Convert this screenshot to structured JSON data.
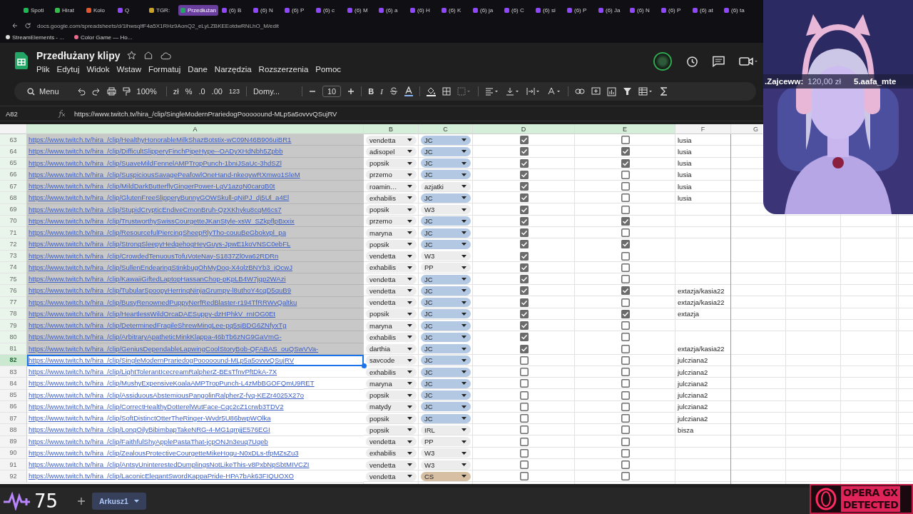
{
  "browser": {
    "tabs": [
      {
        "label": "Spoti",
        "color": "#1db954",
        "selected": false
      },
      {
        "label": "Hirat",
        "color": "#2fbf4a",
        "selected": false
      },
      {
        "label": "Kolo",
        "color": "#e4572e",
        "selected": false
      },
      {
        "label": "Q",
        "color": "#9146ff",
        "selected": false
      },
      {
        "label": "TGR:",
        "color": "#c9a227",
        "selected": false
      },
      {
        "label": "Przedłużan",
        "color": "#23a566",
        "selected": true
      },
      {
        "label": "(6) B",
        "color": "#9146ff",
        "selected": false
      },
      {
        "label": "(6) N",
        "color": "#9146ff",
        "selected": false
      },
      {
        "label": "(6) P",
        "color": "#9146ff",
        "selected": false
      },
      {
        "label": "(6) c",
        "color": "#9146ff",
        "selected": false
      },
      {
        "label": "(6) M",
        "color": "#9146ff",
        "selected": false
      },
      {
        "label": "(6) a",
        "color": "#9146ff",
        "selected": false
      },
      {
        "label": "(6) H",
        "color": "#9146ff",
        "selected": false
      },
      {
        "label": "(6) K",
        "color": "#9146ff",
        "selected": false
      },
      {
        "label": "(6) ja",
        "color": "#9146ff",
        "selected": false
      },
      {
        "label": "(6) C",
        "color": "#9146ff",
        "selected": false
      },
      {
        "label": "(6) si",
        "color": "#9146ff",
        "selected": false
      },
      {
        "label": "(6) P",
        "color": "#9146ff",
        "selected": false
      },
      {
        "label": "(6) Ja",
        "color": "#9146ff",
        "selected": false
      },
      {
        "label": "(6) N",
        "color": "#9146ff",
        "selected": false
      },
      {
        "label": "(6) P",
        "color": "#9146ff",
        "selected": false
      },
      {
        "label": "(6) at",
        "color": "#9146ff",
        "selected": false
      },
      {
        "label": "(6) ta",
        "color": "#9146ff",
        "selected": false
      }
    ],
    "url": "docs.google.com/spreadsheets/d/1lhwsqlfF4a5X1RHz9AonQ2_eLyLZBKEEotdwRNLhO_M/edit",
    "bookmarks": [
      "StreamElements - ...",
      "Color Game — Ho..."
    ]
  },
  "sheets": {
    "title": "Przedłużany klipy",
    "menu": [
      "Plik",
      "Edytuj",
      "Widok",
      "Wstaw",
      "Formatuj",
      "Dane",
      "Narzędzia",
      "Rozszerzenia",
      "Pomoc"
    ],
    "toolbar": {
      "search": "Menu",
      "zoom": "100%",
      "currency": "zł",
      "percent": "%",
      "dec_less": ".0",
      "dec_more": ".00",
      "number_format": "123",
      "font": "Domy...",
      "font_size": "10",
      "bold": "B",
      "italic": "I"
    },
    "name_box": "A82",
    "formula": "https://www.twitch.tv/hira_/clip/SingleModernPrariedogPooooound-MLp5a5ovvvQSujRV",
    "columns": [
      {
        "label": "A",
        "selected": true
      },
      {
        "label": "B",
        "selected": true
      },
      {
        "label": "C",
        "selected": true
      },
      {
        "label": "D",
        "selected": true
      },
      {
        "label": "E",
        "selected": true
      },
      {
        "label": "F",
        "selected": false
      },
      {
        "label": "G",
        "selected": false
      }
    ],
    "rows": [
      {
        "num": "63",
        "a": "https://www.twitch.tv/hira_/clip/HealthyHonorableMilkShazBotstix-wC09N46B906uiBR1",
        "b": "vendetta",
        "c": {
          "value": "JC",
          "color": "#b3c8e2"
        },
        "d_checked": true,
        "e_checked": false,
        "f": "lusia",
        "shaded": true,
        "selected": false
      },
      {
        "num": "64",
        "a": "https://www.twitch.tv/hira_/clip/DifficultSlipperyFinchPipeHype--OADyXHdNbh5Zpbb",
        "b": "adisopel",
        "c": {
          "value": "JC",
          "color": "#b3c8e2"
        },
        "d_checked": true,
        "e_checked": true,
        "f": "lusia",
        "shaded": true,
        "selected": false
      },
      {
        "num": "65",
        "a": "https://www.twitch.tv/hira_/clip/SuaveMildFennelAMPTropPunch-1bniJSaUc-3hdSZl",
        "b": "popsik",
        "c": {
          "value": "JC",
          "color": "#b3c8e2"
        },
        "d_checked": true,
        "e_checked": true,
        "f": "lusia",
        "shaded": true,
        "selected": false
      },
      {
        "num": "66",
        "a": "https://www.twitch.tv/hira_/clip/SuspiciousSavagePeafowlOneHand-nkeoywRXmwo1SleM",
        "b": "przemo",
        "c": {
          "value": "JC",
          "color": "#b3c8e2"
        },
        "d_checked": true,
        "e_checked": false,
        "f": "lusia",
        "shaded": true,
        "selected": false
      },
      {
        "num": "67",
        "a": "https://www.twitch.tv/hira_/clip/MildDarkButterflyGingerPower-LqV1azqN0carqB0t",
        "b": "roamin…",
        "c": {
          "value": "azjatki",
          "color": "#ececec"
        },
        "d_checked": true,
        "e_checked": false,
        "f": "lusia",
        "shaded": true,
        "selected": false
      },
      {
        "num": "68",
        "a": "https://www.twitch.tv/hira_/clip/GlutenFreeSlipperyBunnyGOWSkull-qNiPJ_dj5Ul_a4El",
        "b": "exhabilis",
        "c": {
          "value": "JC",
          "color": "#b3c8e2"
        },
        "d_checked": true,
        "e_checked": false,
        "f": "lusia",
        "shaded": true,
        "selected": false
      },
      {
        "num": "69",
        "a": "https://www.twitch.tv/hira_/clip/StupidCrypticEndiveCmonBruh-QzXKhyku8cqM6cs7",
        "b": "popsik",
        "c": {
          "value": "W3",
          "color": "#ececec"
        },
        "d_checked": true,
        "e_checked": false,
        "shaded": true,
        "selected": false
      },
      {
        "num": "70",
        "a": "https://www.twitch.tv/hira_/clip/TrustworthySwissCourgetteJKanStyle-xsW_SZkpflpBxxix",
        "b": "przemo",
        "c": {
          "value": "JC",
          "color": "#b3c8e2"
        },
        "d_checked": true,
        "e_checked": true,
        "shaded": true,
        "selected": false
      },
      {
        "num": "71",
        "a": "https://www.twitch.tv/hira_/clip/ResourcefulPiercingSheepRlyTho-couuBeGbokvpl_pa",
        "b": "maryna",
        "c": {
          "value": "JC",
          "color": "#b3c8e2"
        },
        "d_checked": true,
        "e_checked": false,
        "shaded": true,
        "selected": false
      },
      {
        "num": "72",
        "a": "https://www.twitch.tv/hira_/clip/StrongSleepyHedgehogHeyGuys-JpwE1koVNSC0ebFL",
        "b": "popsik",
        "c": {
          "value": "JC",
          "color": "#b3c8e2"
        },
        "d_checked": true,
        "e_checked": true,
        "shaded": true,
        "selected": false
      },
      {
        "num": "73",
        "a": "https://www.twitch.tv/hira_/clip/CrowdedTenuousTofuVoteNay-S1837Zl0va62RDRn",
        "b": "vendetta",
        "c": {
          "value": "W3",
          "color": "#ececec"
        },
        "d_checked": true,
        "e_checked": false,
        "shaded": true,
        "selected": false
      },
      {
        "num": "74",
        "a": "https://www.twitch.tv/hira_/clip/SullenEndearingStinkbugOhMyDog-X4olzBNYb3_jOcwJ",
        "b": "exhabilis",
        "c": {
          "value": "PP",
          "color": "#ececec"
        },
        "d_checked": true,
        "e_checked": false,
        "shaded": true,
        "selected": false
      },
      {
        "num": "75",
        "a": "https://www.twitch.tv/hira_/clip/KawaiiGiftedLaptopHassanChop-pKpLB4W7jqp2WAzi",
        "b": "vendetta",
        "c": {
          "value": "JC",
          "color": "#b3c8e2"
        },
        "d_checked": true,
        "e_checked": false,
        "shaded": true,
        "selected": false
      },
      {
        "num": "76",
        "a": "https://www.twitch.tv/hira_/clip/TubularSpoopyHerringNinjaGrumpy-l8uthoY4cqD5quB9",
        "b": "vendetta",
        "c": {
          "value": "JC",
          "color": "#b3c8e2"
        },
        "d_checked": true,
        "e_checked": true,
        "f": "extazja/kasia22",
        "shaded": true,
        "selected": false
      },
      {
        "num": "77",
        "a": "https://www.twitch.tv/hira_/clip/BusyRenownedPuppyNerfRedBlaster-r194TfRRWvQaltku",
        "b": "vendetta",
        "c": {
          "value": "JC",
          "color": "#b3c8e2"
        },
        "d_checked": true,
        "e_checked": false,
        "f": "extazja/kasia22",
        "shaded": true,
        "selected": false
      },
      {
        "num": "78",
        "a": "https://www.twitch.tv/hira_/clip/HeartlessWildOrcaDAESuppy-dzHPhkV_rnIOG0Et",
        "b": "popsik",
        "c": {
          "value": "JC",
          "color": "#b3c8e2"
        },
        "d_checked": true,
        "e_checked": true,
        "f": "extazja",
        "shaded": true,
        "selected": false
      },
      {
        "num": "79",
        "a": "https://www.twitch.tv/hira_/clip/DeterminedFragileShrewMingLee-pq5sjBDG6ZNfyxTg",
        "b": "maryna",
        "c": {
          "value": "JC",
          "color": "#b3c8e2"
        },
        "d_checked": true,
        "e_checked": false,
        "shaded": true,
        "selected": false
      },
      {
        "num": "80",
        "a": "https://www.twitch.tv/hira_/clip/ArbitraryApatheticMinkKlappa-46bTb6zNG9GaVmG-",
        "b": "exhabilis",
        "c": {
          "value": "JC",
          "color": "#b3c8e2"
        },
        "d_checked": true,
        "e_checked": false,
        "shaded": true,
        "selected": false
      },
      {
        "num": "81",
        "a": "https://www.twitch.tv/hira_/clip/GeniusDependableLapwingCoolStoryBob-QFABAS_ouQSwVVa-",
        "b": "darthia",
        "c": {
          "value": "JC",
          "color": "#b3c8e2"
        },
        "d_checked": true,
        "e_checked": false,
        "f": "extazja/kasia22",
        "shaded": true,
        "selected": false
      },
      {
        "num": "82",
        "a": "https://www.twitch.tv/hira_/clip/SingleModernPrariedogPooooound-MLp5a5ovvvQSujRV",
        "b": "savcode",
        "c": {
          "value": "JC",
          "color": "#b3c8e2"
        },
        "d_checked": false,
        "e_checked": false,
        "f": "julcziana2",
        "shaded": false,
        "selected": true
      },
      {
        "num": "83",
        "a": "https://www.twitch.tv/hira_/clip/LightTolerantIcecreamRalpherZ-BEsTfnvPftDkA-7X",
        "b": "exhabilis",
        "c": {
          "value": "JC",
          "color": "#b3c8e2"
        },
        "d_checked": false,
        "e_checked": false,
        "f": "julcziana2",
        "shaded": false,
        "selected": false
      },
      {
        "num": "84",
        "a": "https://www.twitch.tv/hira_/clip/MushyExpensiveKoalaAMPTropPunch-L4zMbBGOFQmU9RET",
        "b": "maryna",
        "c": {
          "value": "JC",
          "color": "#b3c8e2"
        },
        "d_checked": false,
        "e_checked": false,
        "f": "julcziana2",
        "shaded": false,
        "selected": false
      },
      {
        "num": "85",
        "a": "https://www.twitch.tv/hira_/clip/AssiduousAbstemiousPangolinRalpherZ-fyq-KEZr4025X27o",
        "b": "popsik",
        "c": {
          "value": "JC",
          "color": "#b3c8e2"
        },
        "d_checked": false,
        "e_checked": false,
        "f": "julcziana2",
        "shaded": false,
        "selected": false
      },
      {
        "num": "86",
        "a": "https://www.twitch.tv/hira_/clip/CorrectHealthyDotterelWutFace-Cqc2cZ1crwb3TDV2",
        "b": "matydy",
        "c": {
          "value": "JC",
          "color": "#b3c8e2"
        },
        "d_checked": false,
        "e_checked": false,
        "f": "julcziana2",
        "shaded": false,
        "selected": false
      },
      {
        "num": "87",
        "a": "https://www.twitch.tv/hira_/clip/SoftDistinctOtterTheRinger-Wvdr5U86bwpWOlka",
        "b": "popsik",
        "c": {
          "value": "JC",
          "color": "#b3c8e2"
        },
        "d_checked": false,
        "e_checked": false,
        "f": "julcziana2",
        "shaded": false,
        "selected": false
      },
      {
        "num": "88",
        "a": "https://www.twitch.tv/hira_/clip/LongOilyBibimbapTakeNRG-4-MG1qmjjE576EGI",
        "b": "popsik",
        "c": {
          "value": "IRL",
          "color": "#ececec"
        },
        "d_checked": false,
        "e_checked": false,
        "f": "bisza",
        "shaded": false,
        "selected": false
      },
      {
        "num": "89",
        "a": "https://www.twitch.tv/hira_/clip/FaithfulShyApplePastaThat-jcpONJn3euq7Uqeb",
        "b": "vendetta",
        "c": {
          "value": "PP",
          "color": "#ececec"
        },
        "d_checked": false,
        "e_checked": false,
        "shaded": false,
        "selected": false
      },
      {
        "num": "90",
        "a": "https://www.twitch.tv/hira_/clip/ZealousProtectiveCourgetteMikeHogu-N0xDLs-tfpMZsZu3",
        "b": "exhabilis",
        "c": {
          "value": "W3",
          "color": "#ececec"
        },
        "d_checked": false,
        "e_checked": false,
        "shaded": false,
        "selected": false
      },
      {
        "num": "91",
        "a": "https://www.twitch.tv/hira_/clip/AntsyUninterestedDumplingsNotLikeThis-v8PxbNpSbtMIVCZI",
        "b": "vendetta",
        "c": {
          "value": "W3",
          "color": "#ececec"
        },
        "d_checked": false,
        "e_checked": false,
        "shaded": false,
        "selected": false
      },
      {
        "num": "92",
        "a": "https://www.twitch.tv/hira_/clip/LaconicElegantSwordKappaPride-HPA7bAk63FIQUOXO",
        "b": "vendetta",
        "c": {
          "value": "CS",
          "color": "#d7bfa4"
        },
        "d_checked": false,
        "e_checked": false,
        "shaded": false,
        "selected": false
      }
    ],
    "sheet_tab": "Arkusz1"
  },
  "stream_overlay": {
    "ticker": [
      ".Zajceww:",
      "120,00 zł",
      "5.aafa_mte"
    ],
    "counter": "75",
    "badge": [
      "OPERA GX",
      "DETECTED"
    ],
    "camera": {
      "kind": "picture"
    }
  }
}
